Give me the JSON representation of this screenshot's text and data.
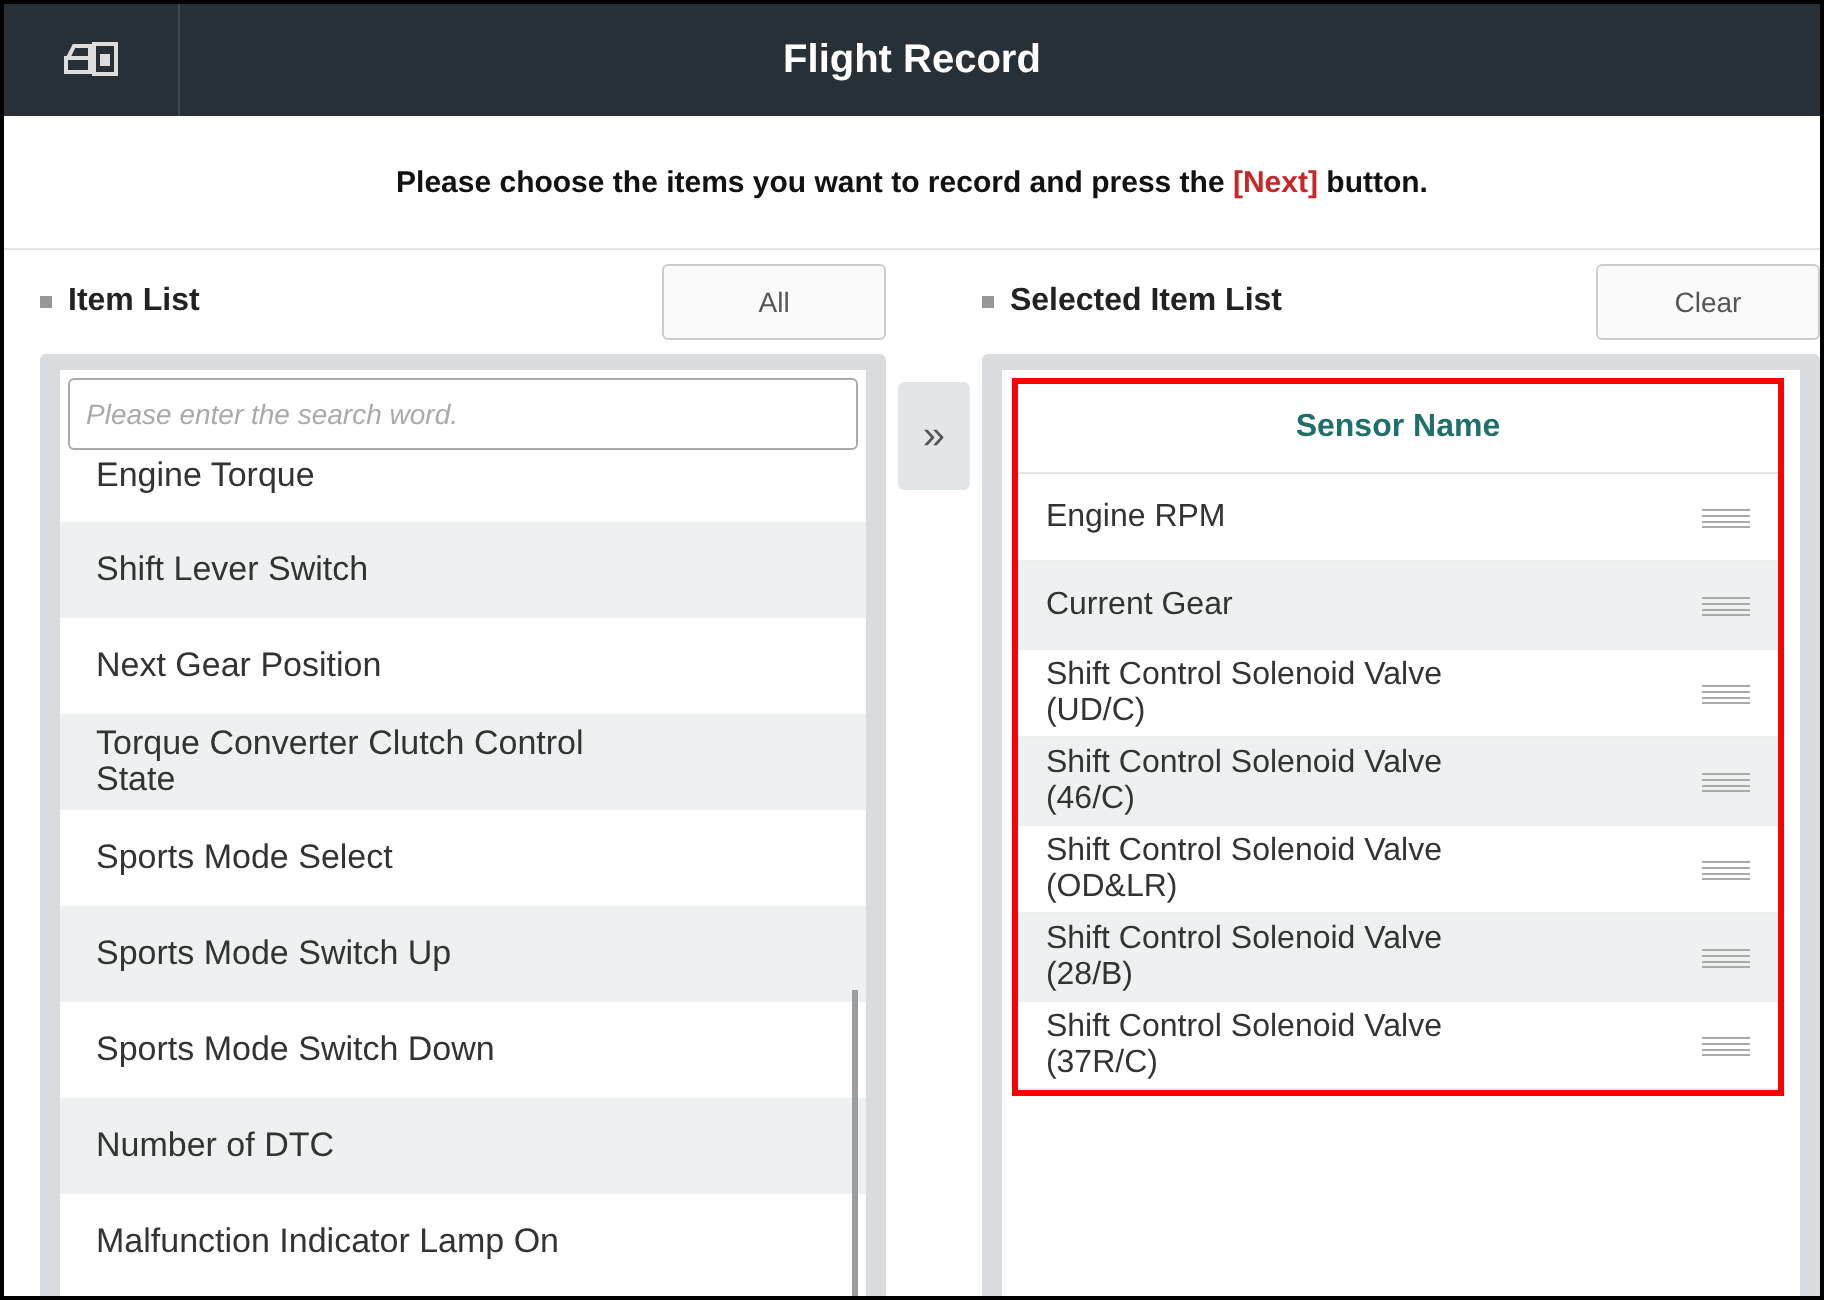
{
  "window": {
    "title": "Flight Record"
  },
  "instruction": {
    "before": "Please choose the items you want to record and press the ",
    "emphasis": "[Next]",
    "after": " button."
  },
  "item_list": {
    "title": "Item List",
    "button": "All",
    "search": {
      "placeholder": "Please enter the search word."
    },
    "items": [
      "Engine Torque",
      "Shift Lever Switch",
      "Next Gear Position",
      "Torque Converter Clutch Control State",
      "Sports Mode Select",
      "Sports Mode Switch Up",
      "Sports Mode Switch Down",
      "Number of DTC",
      "Malfunction Indicator Lamp On"
    ]
  },
  "move_button": "»",
  "selected_list": {
    "title": "Selected Item List",
    "button": "Clear",
    "highlighted": true,
    "column": "Sensor Name",
    "items": [
      "Engine RPM",
      "Current Gear",
      "Shift Control Solenoid Valve (UD/C)",
      "Shift Control Solenoid Valve (46/C)",
      "Shift Control Solenoid Valve (OD&LR)",
      "Shift Control Solenoid Valve (28/B)",
      "Shift Control Solenoid Valve (37R/C)"
    ]
  }
}
